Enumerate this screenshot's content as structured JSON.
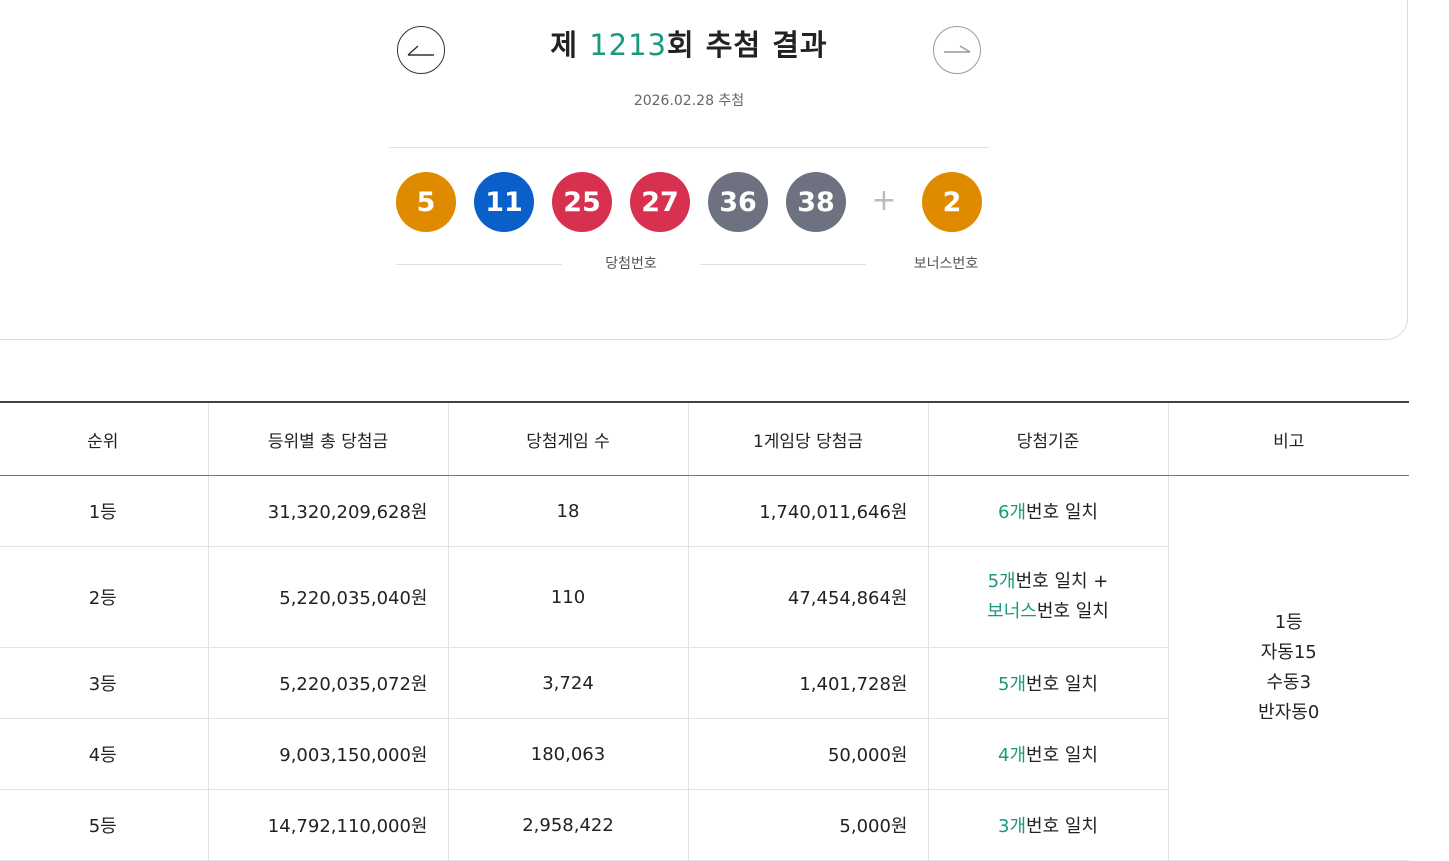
{
  "header": {
    "title_prefix": "제 ",
    "round_number": "1213",
    "title_suffix": "회 추첨 결과",
    "draw_date": "2026.02.28 추첨",
    "prev_icon": "arrow-left-icon",
    "next_icon": "arrow-right-icon"
  },
  "numbers": {
    "winning": [
      {
        "value": "5",
        "color": "#e08a00"
      },
      {
        "value": "11",
        "color": "#0a5fc8"
      },
      {
        "value": "25",
        "color": "#d8304f"
      },
      {
        "value": "27",
        "color": "#d8304f"
      },
      {
        "value": "36",
        "color": "#6e7280"
      },
      {
        "value": "38",
        "color": "#6e7280"
      }
    ],
    "plus_sign": "+",
    "bonus": {
      "value": "2",
      "color": "#e08a00"
    },
    "winning_label": "당첨번호",
    "bonus_label": "보너스번호"
  },
  "table": {
    "headers": [
      "순위",
      "등위별 총 당첨금",
      "당첨게임 수",
      "1게임당 당첨금",
      "당첨기준",
      "비고"
    ],
    "rows": [
      {
        "rank": "1등",
        "total": "31,320,209,628원",
        "games": "18",
        "per_game": "1,740,011,646원",
        "criteria_hl": "6개",
        "criteria_rest": "번호 일치"
      },
      {
        "rank": "2등",
        "total": "5,220,035,040원",
        "games": "110",
        "per_game": "47,454,864원",
        "criteria_hl": "5개",
        "criteria_rest": "번호 일치 +",
        "criteria2_hl": "보너스",
        "criteria2_rest": "번호 일치"
      },
      {
        "rank": "3등",
        "total": "5,220,035,072원",
        "games": "3,724",
        "per_game": "1,401,728원",
        "criteria_hl": "5개",
        "criteria_rest": "번호 일치"
      },
      {
        "rank": "4등",
        "total": "9,003,150,000원",
        "games": "180,063",
        "per_game": "50,000원",
        "criteria_hl": "4개",
        "criteria_rest": "번호 일치"
      },
      {
        "rank": "5등",
        "total": "14,792,110,000원",
        "games": "2,958,422",
        "per_game": "5,000원",
        "criteria_hl": "3개",
        "criteria_rest": "번호 일치"
      }
    ],
    "note": [
      "1등",
      "자동15",
      "수동3",
      "반자동0"
    ]
  }
}
